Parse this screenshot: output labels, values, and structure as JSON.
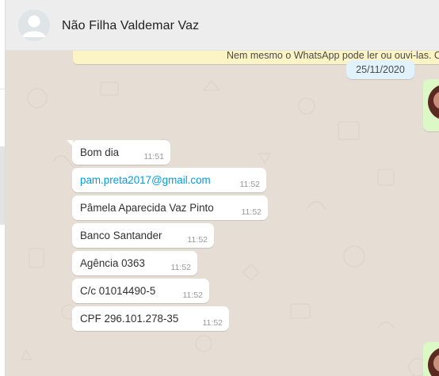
{
  "header": {
    "contact_name": "Não Filha Valdemar Vaz"
  },
  "chat": {
    "encryption_notice": "Nem mesmo o WhatsApp pode ler ou ouvi-las. C",
    "date_chip": "25/11/2020",
    "messages": [
      {
        "text": "Bom dia",
        "time": "11:51",
        "is_link": false
      },
      {
        "text": "pam.preta2017@gmail.com",
        "time": "11:52",
        "is_link": true
      },
      {
        "text": "Pâmela Aparecida Vaz Pinto",
        "time": "11:52",
        "is_link": false
      },
      {
        "text": "Banco Santander",
        "time": "11:52",
        "is_link": false
      },
      {
        "text": "Agência 0363",
        "time": "11:52",
        "is_link": false
      },
      {
        "text": "C/c 01014490-5",
        "time": "11:52",
        "is_link": false
      },
      {
        "text": "CPF 296.101.278-35",
        "time": "11:52",
        "is_link": false
      }
    ]
  },
  "colors": {
    "chat_bg": "#e6ded5",
    "header_bg": "#ededed",
    "incoming_bubble": "#ffffff",
    "outgoing_bubble": "#dcf8c6",
    "link": "#039be5",
    "system_notice": "#fdf4c5",
    "date_chip": "#e1f2fb"
  },
  "icons": {
    "avatar": "default-person-avatar-icon"
  }
}
